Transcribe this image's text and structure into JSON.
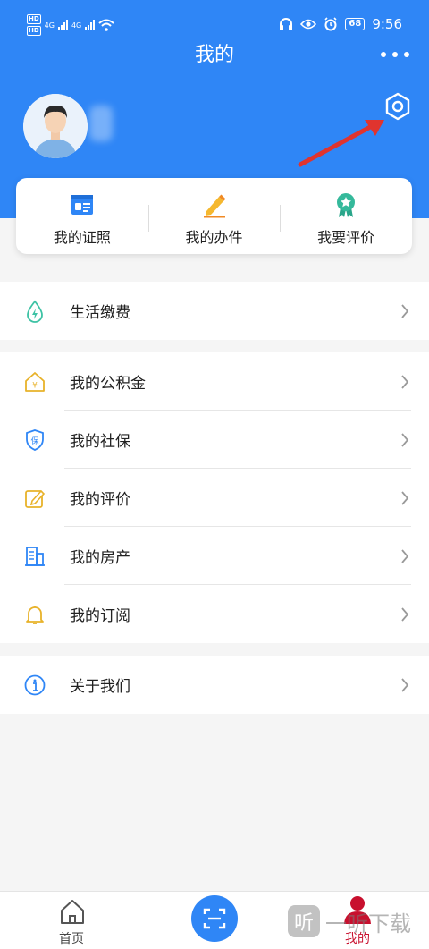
{
  "status_bar": {
    "hd1": "HD",
    "hd2": "HD",
    "net1": "4G",
    "net2": "4G",
    "battery": "68",
    "time": "9:56"
  },
  "nav": {
    "title": "我的",
    "more_icon": "more-dots-icon"
  },
  "profile": {
    "avatar_icon": "user-avatar",
    "settings_icon": "settings-hexagon-icon"
  },
  "quick_actions": [
    {
      "label": "我的证照",
      "icon": "id-card-icon",
      "color": "#2f86f6"
    },
    {
      "label": "我的办件",
      "icon": "pencil-icon",
      "color": "#f5b82e"
    },
    {
      "label": "我要评价",
      "icon": "award-star-icon",
      "color": "#35b99b"
    }
  ],
  "sections": {
    "life": [
      {
        "label": "生活缴费",
        "icon": "water-drop-bolt-icon",
        "color": "#3cc2a4"
      }
    ],
    "personal": [
      {
        "label": "我的公积金",
        "icon": "house-yen-icon",
        "color": "#e8b22a"
      },
      {
        "label": "我的社保",
        "icon": "shield-bao-icon",
        "color": "#2f86f6"
      },
      {
        "label": "我的评价",
        "icon": "edit-square-icon",
        "color": "#e8b22a"
      },
      {
        "label": "我的房产",
        "icon": "building-icon",
        "color": "#2f86f6"
      },
      {
        "label": "我的订阅",
        "icon": "bell-icon",
        "color": "#e8b22a"
      }
    ],
    "about": [
      {
        "label": "关于我们",
        "icon": "info-icon",
        "color": "#2f86f6"
      }
    ]
  },
  "bottom_nav": {
    "home_label": "首页",
    "mine_label": "我的",
    "scan_icon": "scan-icon",
    "active_color": "#c8102e"
  },
  "watermark": {
    "badge": "听",
    "text": "一听下载"
  }
}
